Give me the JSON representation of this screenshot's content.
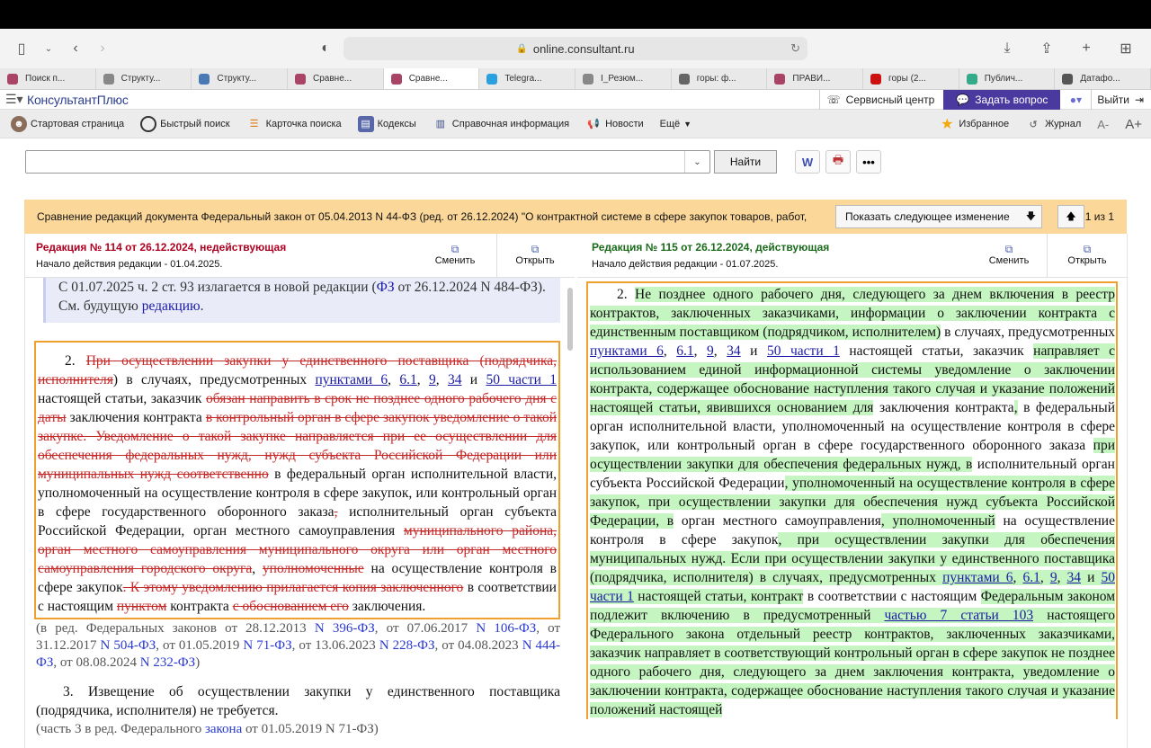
{
  "browser": {
    "url": "online.consultant.ru",
    "tabs": [
      "Поиск п...",
      "Структу...",
      "Структу...",
      "Сравне...",
      "Сравне...",
      "Telegra...",
      "I_Резюм...",
      "горы: ф...",
      "ПРАВИ...",
      "горы (2...",
      "Публич...",
      "Датафо..."
    ]
  },
  "app": {
    "logo": "КонсультантПлюс",
    "service": "Сервисный центр",
    "ask": "Задать вопрос",
    "exit": "Выйти"
  },
  "nav": {
    "items": [
      "Стартовая страница",
      "Быстрый поиск",
      "Карточка поиска",
      "Кодексы",
      "Справочная информация",
      "Новости",
      "Ещё"
    ],
    "favorites": "Избранное",
    "journal": "Журнал",
    "font_dec": "A-",
    "font_inc": "A+"
  },
  "search": {
    "value": "",
    "find": "Найти"
  },
  "compare": {
    "title": "Сравнение редакций документа Федеральный закон от 05.04.2013 N 44-ФЗ (ред. от 26.12.2024) \"О контрактной системе в сфере закупок товаров, работ, услуг для обеспечения государственных и муниципальных нужд\"",
    "next": "Показать следующее изменение",
    "page": "1 из 1"
  },
  "left": {
    "edition": "Редакция № 114 от 26.12.2024, недействующая",
    "start": "Начало действия редакции - 01.04.2025.",
    "change": "Сменить",
    "open": "Открыть",
    "note_top_a": "С 01.07.2025 ч. 2 ст. 93 излагается в новой редакции (",
    "note_top_link": "ФЗ",
    "note_top_b": " от 26.12.2024 N 484-ФЗ). См. будущую ",
    "note_top_link2": "редакцию",
    "note_top_c": ".",
    "p2_num": "2. ",
    "s1": "При осуществлении закупки у единственного поставщика (подрядчика, исполнителя",
    "t1": ") в случаях, предусмотренных ",
    "l1": "пунктами 6",
    "l2": "6.1",
    "l3": "9",
    "l4": "34",
    "t_and": " и ",
    "l5": "50 части 1",
    "t2": " настоящей статьи, заказчик ",
    "s2": "обязан направить в срок не позднее одного рабочего дня с даты",
    "t3": " заключения контракта ",
    "s3": "в контрольный орган в сфере закупок уведомление о такой закупке. Уведомление о такой закупке направляется при ее осуществлении для обеспечения федеральных нужд, нужд субъекта Российской Федерации или муниципальных нужд соответственно",
    "t4": " в федеральный орган исполнительной власти, уполномоченный на осуществление контроля в сфере закупок, или контрольный орган в сфере государственного оборонного заказа",
    "s4": ",",
    "t5": " исполнительный орган субъекта Российской Федерации, орган местного самоуправления ",
    "s5": "муниципального района, орган местного самоуправления муниципального округа или орган местного самоуправления городского округа",
    "t6": ", ",
    "s6": "уполномоченные",
    "t7": " на осуществление контроля в сфере закупок",
    "s7": ". К этому уведомлению прилагается копия заключенного",
    "t8": " в соответствии с настоящим ",
    "s8": "пунктом",
    "t9": " контракта ",
    "s9": "с обоснованием его",
    "t10": " заключения.",
    "note2_a": "(в ред. Федеральных законов от 28.12.2013 ",
    "n1": "N 396-ФЗ",
    "note2_b": ", от 07.06.2017 ",
    "n2": "N 106-ФЗ",
    "note2_c": ", от 31.12.2017 ",
    "n3": "N 504-ФЗ",
    "note2_d": ", от 01.05.2019 ",
    "n4": "N 71-ФЗ",
    "note2_e": ", от 13.06.2023 ",
    "n5": "N 228-ФЗ",
    "note2_f": ", от 04.08.2023 ",
    "n6": "N 444-ФЗ",
    "note2_g": ", от 08.08.2024 ",
    "n7": "N 232-ФЗ",
    "note2_h": ")",
    "p3": "3. Извещение об осуществлении закупки у единственного поставщика (подрядчика, исполнителя) не требуется.",
    "note3_a": "(часть 3 в ред. Федерального ",
    "note3_link": "закона",
    "note3_b": " от 01.05.2019 N 71-ФЗ)"
  },
  "right": {
    "edition": "Редакция № 115 от 26.12.2024, действующая",
    "start": "Начало действия редакции - 01.07.2025.",
    "change": "Сменить",
    "open": "Открыть",
    "p2_num": "2. ",
    "h1": "Не позднее одного рабочего дня, следующего за днем включения в реестр контрактов, заключенных заказчиками, информации о заключении контракта с единственным поставщиком (подрядчиком, исполнителем)",
    "t1": " в случаях, предусмотренных ",
    "l1": "пунктами 6",
    "l2": "6.1",
    "l3": "9",
    "l4": "34",
    "t_and": " и ",
    "l5": "50 части 1",
    "t2": " настоящей статьи, заказчик ",
    "h2": "направляет с использованием единой информационной системы уведомление о заключении контракта, содержащее обоснование наступления такого случая и указание положений настоящей статьи, явившихся основанием для",
    "t3": " заключения контракта",
    "h3": ",",
    "t4": " в федеральный орган исполнительной власти, уполномоченный на осуществление контроля в сфере закупок, или контрольный орган в сфере государственного оборонного заказа ",
    "h4": "при осуществлении закупки для обеспечения федеральных нужд, в",
    "t5": " исполнительный орган субъекта Российской Федерации",
    "h5": ", уполномоченный на осуществление контроля в сфере закупок, при осуществлении закупки для обеспечения нужд субъекта Российской Федерации, в",
    "t6": " орган местного самоуправления",
    "h6": ", уполномоченный",
    "t7": " на осуществление контроля в сфере закупок",
    "h7": ", при осуществлении закупки для обеспечения муниципальных нужд. Если при осуществлении закупки у единственного поставщика (подрядчика, исполнителя) в случаях, предусмотренных ",
    "m1": "пунктами 6",
    "m2": "6.1",
    "m3": "9",
    "m4": "34",
    "m_and": " и ",
    "m5": "50 части 1",
    "h8": " настоящей статьи, контракт",
    "t8": " в соответствии с настоящим ",
    "h9": "Федеральным законом подлежит включению в предусмотренный ",
    "m6": "частью 7 статьи 103",
    "h10": " настоящего Федерального закона отдельный реестр контрактов, заключенных заказчиками, заказчик направляет в соответствующий контрольный орган в сфере закупок не позднее одного рабочего дня, следующего за днем заключения контракта, уведомление о заключении контракта, содержащее обоснование наступления такого случая и указание положений настоящей"
  }
}
